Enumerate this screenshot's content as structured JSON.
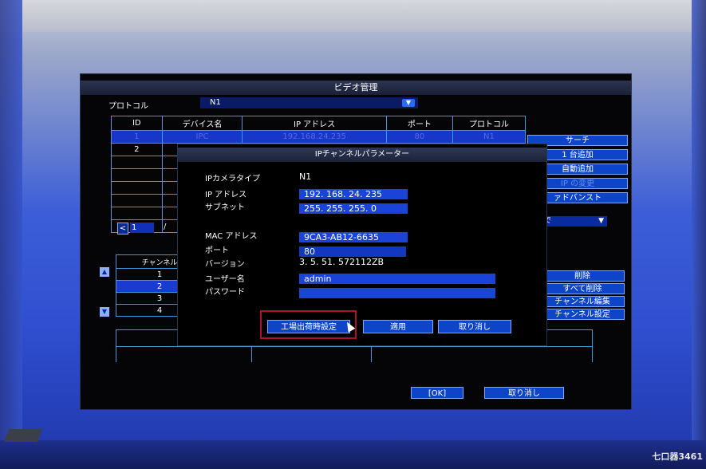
{
  "main": {
    "title": "ビデオ管理",
    "protocol_label": "プロトコル",
    "protocol_value": "N1",
    "table_headers": [
      "ID",
      "デバイス名",
      "IP アドレス",
      "ポート",
      "プロトコル"
    ],
    "rows": [
      {
        "id": "1",
        "name": "IPC",
        "ip": "192.168.24.235",
        "port": "80",
        "proto": "N1"
      },
      {
        "id": "2",
        "name": "",
        "ip": "",
        "port": "",
        "proto": ""
      }
    ],
    "side_buttons": [
      "サーチ",
      "1 台追加",
      "自動追加",
      "IP の変更",
      "ァドバンスト"
    ],
    "page_current": "1",
    "page_sep": "/",
    "right_select": "で",
    "channel_header": "チャンネル",
    "channels": [
      "1",
      "2",
      "3",
      "4"
    ],
    "right_buttons": [
      "削除",
      "すべて削除",
      "チャンネル編集",
      "チャンネル設定"
    ],
    "ok_button": "[OK]",
    "cancel_button": "取り消し"
  },
  "dialog": {
    "title": "IPチャンネルパラメーター",
    "labels": {
      "camera_type": "IPカメラタイプ",
      "ip": "IP アドレス",
      "subnet": "サブネット",
      "mac": "MAC アドレス",
      "port": "ポート",
      "version": "バージョン",
      "user": "ユーザー名",
      "password": "パスワード"
    },
    "values": {
      "camera_type": "N1",
      "ip": "192. 168.  24. 235",
      "subnet": "255. 255. 255.   0",
      "mac": "9CA3-AB12-6635",
      "port": "80",
      "version": "3. 5. 51. 572112ZB",
      "user": "admin",
      "password": ""
    },
    "buttons": {
      "factory": "工場出荷時設定",
      "apply": "適用",
      "cancel": "取り消し"
    }
  },
  "watermark": "七口器3461"
}
